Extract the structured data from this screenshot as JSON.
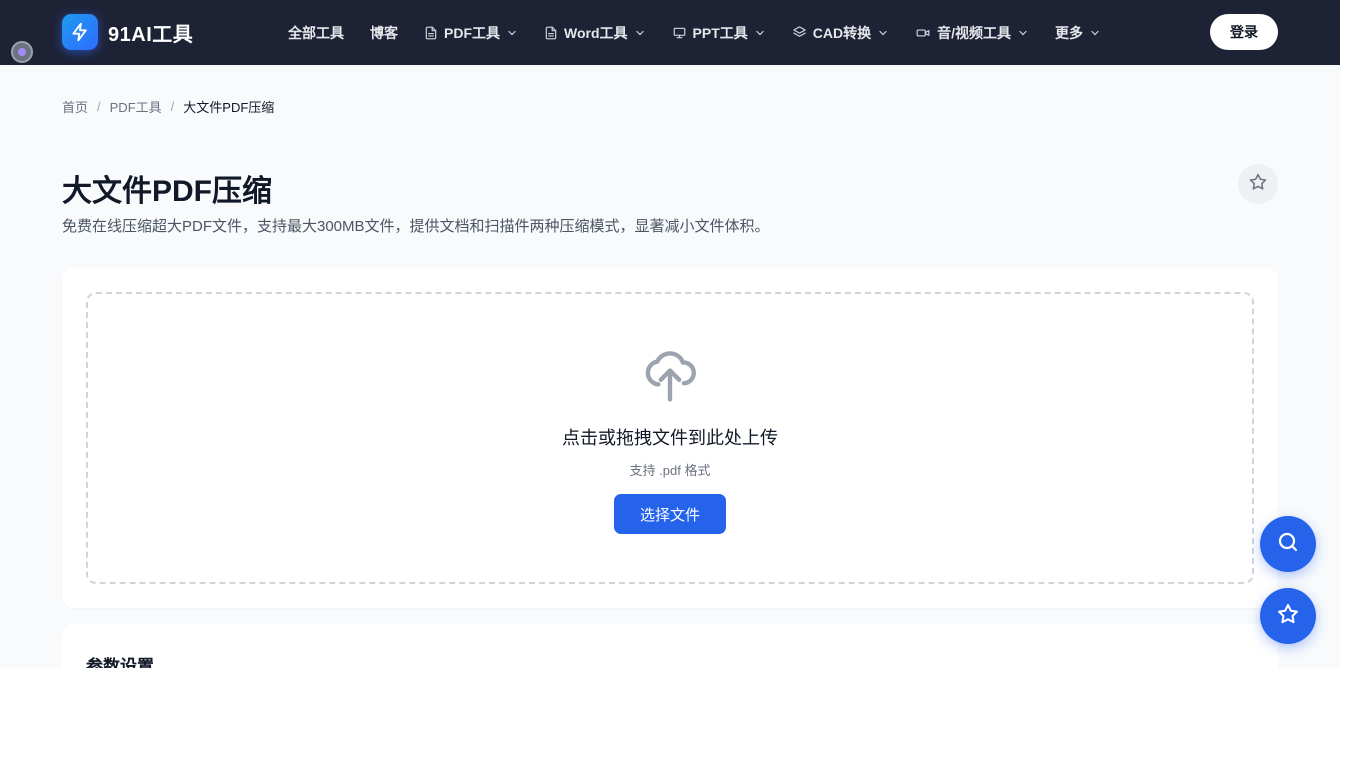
{
  "header": {
    "logo_text": "91AI工具",
    "nav": [
      {
        "label": "全部工具",
        "icon": "",
        "dropdown": false
      },
      {
        "label": "博客",
        "icon": "",
        "dropdown": false
      },
      {
        "label": "PDF工具",
        "icon": "document-icon",
        "dropdown": true
      },
      {
        "label": "Word工具",
        "icon": "document-icon",
        "dropdown": true
      },
      {
        "label": "PPT工具",
        "icon": "presentation-icon",
        "dropdown": true
      },
      {
        "label": "CAD转换",
        "icon": "layers-icon",
        "dropdown": true
      },
      {
        "label": "音/视频工具",
        "icon": "video-icon",
        "dropdown": true
      },
      {
        "label": "更多",
        "icon": "",
        "dropdown": true
      }
    ],
    "login_label": "登录"
  },
  "breadcrumb": {
    "home": "首页",
    "section": "PDF工具",
    "current": "大文件PDF压缩",
    "separator": "/"
  },
  "page": {
    "title": "大文件PDF压缩",
    "description": "免费在线压缩超大PDF文件，支持最大300MB文件，提供文档和扫描件两种压缩模式，显著减小文件体积。"
  },
  "upload": {
    "title": "点击或拖拽文件到此处上传",
    "hint": "支持 .pdf 格式",
    "button_label": "选择文件"
  },
  "settings": {
    "title": "参数设置"
  },
  "colors": {
    "header_bg": "#1e2235",
    "accent": "#2563eb",
    "page_bg": "#f8fafc"
  }
}
